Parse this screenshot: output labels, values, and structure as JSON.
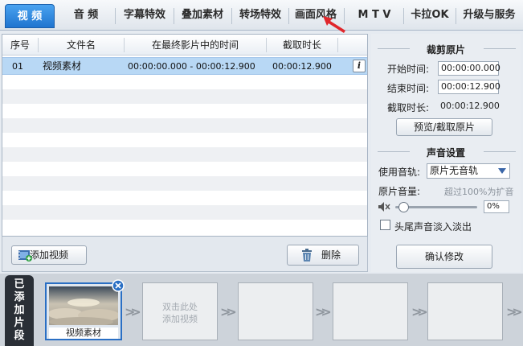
{
  "tabs": [
    {
      "label": "视 频"
    },
    {
      "label": "音 频"
    },
    {
      "label": "字幕特效"
    },
    {
      "label": "叠加素材"
    },
    {
      "label": "转场特效"
    },
    {
      "label": "画面风格"
    },
    {
      "label": "M T V"
    },
    {
      "label": "卡拉OK"
    },
    {
      "label": "升级与服务"
    }
  ],
  "table": {
    "columns": [
      "序号",
      "文件名",
      "在最终影片中的时间",
      "截取时长"
    ],
    "rows": [
      {
        "index": "01",
        "name": "视频素材",
        "time_range": "00:00:00.000 - 00:00:12.900",
        "duration": "00:00:12.900",
        "info": "i"
      }
    ]
  },
  "buttons": {
    "add_video": "添加视频",
    "delete": "删除",
    "preview_trim": "预览/截取原片",
    "confirm": "确认修改"
  },
  "trim": {
    "title": "裁剪原片",
    "start_label": "开始时间:",
    "start_value": "00:00:00.000",
    "end_label": "结束时间:",
    "end_value": "00:00:12.900",
    "duration_label": "截取时长:",
    "duration_value": "00:00:12.900"
  },
  "audio": {
    "title": "声音设置",
    "track_label": "使用音轨:",
    "track_value": "原片无音轨",
    "volume_label": "原片音量:",
    "volume_hint": "超过100%为扩音",
    "volume_level": 0,
    "volume_value": "0%",
    "fade_label": "头尾声音淡入淡出",
    "fade_checked": false
  },
  "clips": {
    "strip_label": [
      "已",
      "添",
      "加",
      "片",
      "段"
    ],
    "first_clip_name": "视频素材",
    "add_hint_line1": "双击此处",
    "add_hint_line2": "添加视频"
  },
  "colors": {
    "accent": "#1f74cf",
    "selected_row": "#b8d8f5",
    "annotation_arrow": "#e0262b"
  }
}
